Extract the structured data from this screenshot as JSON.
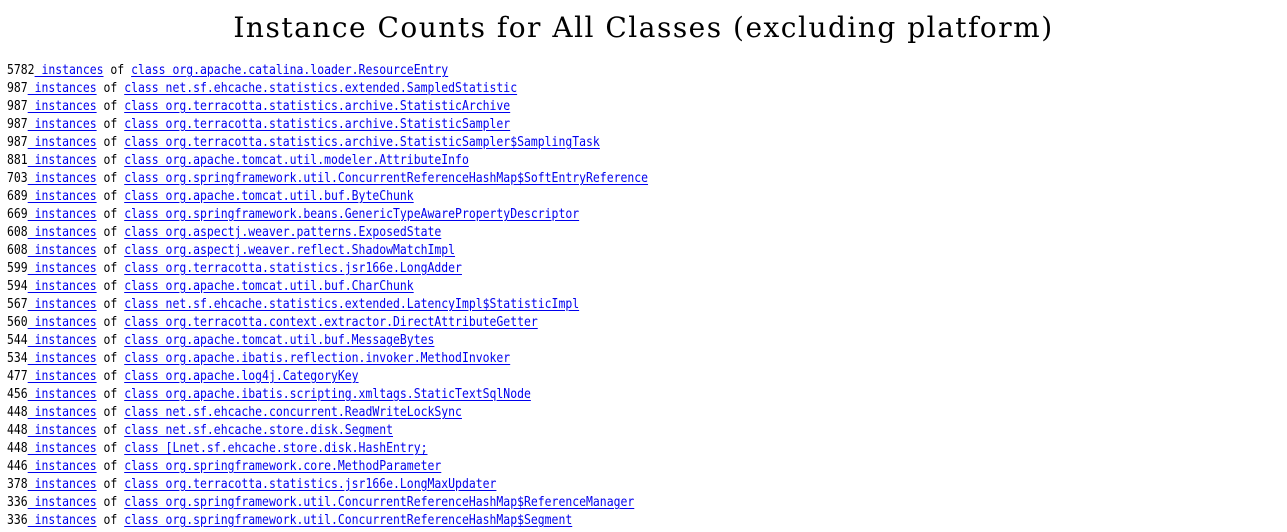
{
  "page": {
    "title": "Instance Counts for All Classes (excluding platform)",
    "background_color": "#ffffff",
    "text_color": "#000000",
    "link_color": "#0000ee",
    "row_prefix_separator": " of ",
    "instances_link_label": " instances",
    "class_keyword": "class "
  },
  "rows": [
    {
      "count": "5782",
      "instances_label": " instances",
      "of": " of ",
      "class_label": "class org.apache.catalina.loader.ResourceEntry"
    },
    {
      "count": "987",
      "instances_label": " instances",
      "of": " of ",
      "class_label": "class net.sf.ehcache.statistics.extended.SampledStatistic"
    },
    {
      "count": "987",
      "instances_label": " instances",
      "of": " of ",
      "class_label": "class org.terracotta.statistics.archive.StatisticArchive"
    },
    {
      "count": "987",
      "instances_label": " instances",
      "of": " of ",
      "class_label": "class org.terracotta.statistics.archive.StatisticSampler"
    },
    {
      "count": "987",
      "instances_label": " instances",
      "of": " of ",
      "class_label": "class org.terracotta.statistics.archive.StatisticSampler$SamplingTask"
    },
    {
      "count": "881",
      "instances_label": " instances",
      "of": " of ",
      "class_label": "class org.apache.tomcat.util.modeler.AttributeInfo"
    },
    {
      "count": "703",
      "instances_label": " instances",
      "of": " of ",
      "class_label": "class org.springframework.util.ConcurrentReferenceHashMap$SoftEntryReference"
    },
    {
      "count": "689",
      "instances_label": " instances",
      "of": " of ",
      "class_label": "class org.apache.tomcat.util.buf.ByteChunk"
    },
    {
      "count": "669",
      "instances_label": " instances",
      "of": " of ",
      "class_label": "class org.springframework.beans.GenericTypeAwarePropertyDescriptor"
    },
    {
      "count": "608",
      "instances_label": " instances",
      "of": " of ",
      "class_label": "class org.aspectj.weaver.patterns.ExposedState"
    },
    {
      "count": "608",
      "instances_label": " instances",
      "of": " of ",
      "class_label": "class org.aspectj.weaver.reflect.ShadowMatchImpl"
    },
    {
      "count": "599",
      "instances_label": " instances",
      "of": " of ",
      "class_label": "class org.terracotta.statistics.jsr166e.LongAdder"
    },
    {
      "count": "594",
      "instances_label": " instances",
      "of": " of ",
      "class_label": "class org.apache.tomcat.util.buf.CharChunk"
    },
    {
      "count": "567",
      "instances_label": " instances",
      "of": " of ",
      "class_label": "class net.sf.ehcache.statistics.extended.LatencyImpl$StatisticImpl"
    },
    {
      "count": "560",
      "instances_label": " instances",
      "of": " of ",
      "class_label": "class org.terracotta.context.extractor.DirectAttributeGetter"
    },
    {
      "count": "544",
      "instances_label": " instances",
      "of": " of ",
      "class_label": "class org.apache.tomcat.util.buf.MessageBytes"
    },
    {
      "count": "534",
      "instances_label": " instances",
      "of": " of ",
      "class_label": "class org.apache.ibatis.reflection.invoker.MethodInvoker"
    },
    {
      "count": "477",
      "instances_label": " instances",
      "of": " of ",
      "class_label": "class org.apache.log4j.CategoryKey"
    },
    {
      "count": "456",
      "instances_label": " instances",
      "of": " of ",
      "class_label": "class org.apache.ibatis.scripting.xmltags.StaticTextSqlNode"
    },
    {
      "count": "448",
      "instances_label": " instances",
      "of": " of ",
      "class_label": "class net.sf.ehcache.concurrent.ReadWriteLockSync"
    },
    {
      "count": "448",
      "instances_label": " instances",
      "of": " of ",
      "class_label": "class net.sf.ehcache.store.disk.Segment"
    },
    {
      "count": "448",
      "instances_label": " instances",
      "of": " of ",
      "class_label": "class [Lnet.sf.ehcache.store.disk.HashEntry;"
    },
    {
      "count": "446",
      "instances_label": " instances",
      "of": " of ",
      "class_label": "class org.springframework.core.MethodParameter"
    },
    {
      "count": "378",
      "instances_label": " instances",
      "of": " of ",
      "class_label": "class org.terracotta.statistics.jsr166e.LongMaxUpdater"
    },
    {
      "count": "336",
      "instances_label": " instances",
      "of": " of ",
      "class_label": "class org.springframework.util.ConcurrentReferenceHashMap$ReferenceManager"
    },
    {
      "count": "336",
      "instances_label": " instances",
      "of": " of ",
      "class_label": "class org.springframework.util.ConcurrentReferenceHashMap$Segment"
    }
  ]
}
